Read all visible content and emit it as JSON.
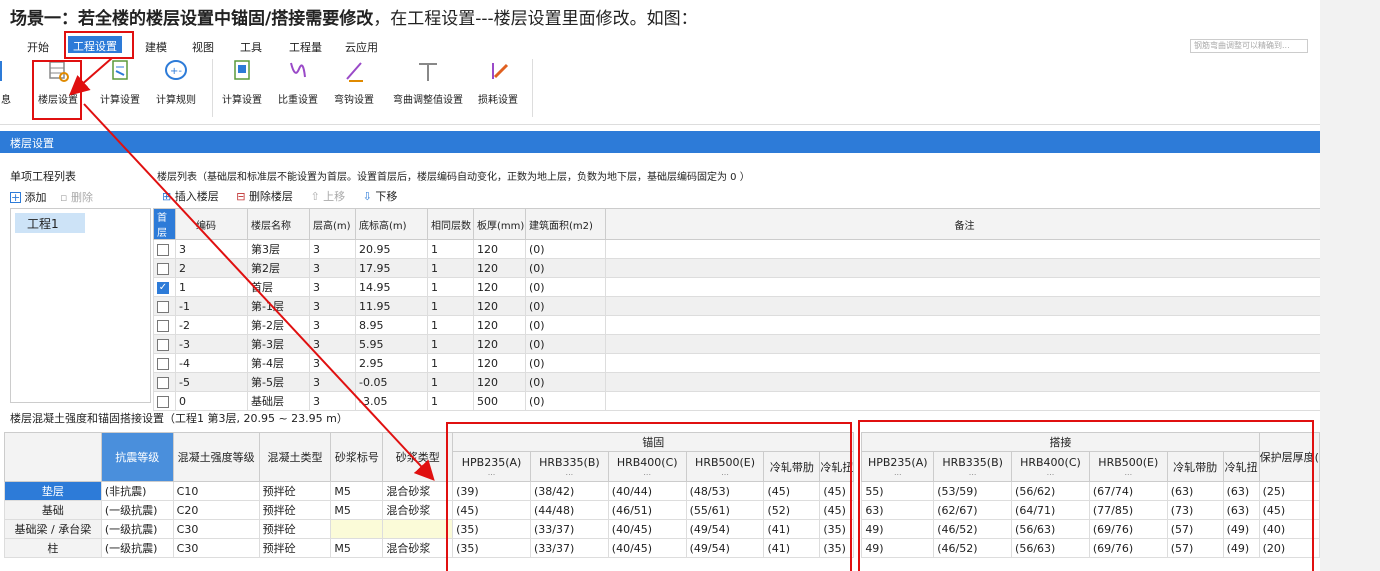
{
  "heading": {
    "bold": "场景一：若全楼的楼层设置中锚固/搭接需要修改",
    "rest": "，在工程设置---楼层设置里面修改。如图："
  },
  "menu": {
    "tabs": [
      "开始",
      "工程设置",
      "建模",
      "视图",
      "工具",
      "工程量",
      "云应用"
    ],
    "active": "工程设置",
    "search_placeholder": "钢筋弯曲调整可以精确到..."
  },
  "ribbon": {
    "buttons": [
      {
        "label": "息",
        "icon": "info-icon"
      },
      {
        "label": "楼层设置",
        "icon": "floor-settings-icon"
      },
      {
        "label": "计算设置",
        "icon": "calc-settings-icon"
      },
      {
        "label": "计算规则",
        "icon": "calc-rules-icon"
      },
      {
        "label": "计算设置",
        "icon": "calc-settings-2-icon"
      },
      {
        "label": "比重设置",
        "icon": "weight-settings-icon"
      },
      {
        "label": "弯钩设置",
        "icon": "hook-settings-icon"
      },
      {
        "label": "弯曲调整值设置",
        "icon": "bend-adjust-icon"
      },
      {
        "label": "损耗设置",
        "icon": "loss-settings-icon"
      }
    ]
  },
  "dialog": {
    "title": "楼层设置"
  },
  "left_panel": {
    "title": "单项工程列表",
    "add_label": "添加",
    "delete_label": "删除",
    "project": "工程1"
  },
  "floor_section": {
    "note": "楼层列表（基础层和标准层不能设置为首层。设置首层后，楼层编码自动变化，正数为地上层，负数为地下层，基础层编码固定为 0 ）",
    "toolbar": {
      "insert": "插入楼层",
      "delete": "删除楼层",
      "up": "上移",
      "down": "下移"
    },
    "columns": [
      "首层",
      "编码",
      "楼层名称",
      "层高(m)",
      "底标高(m)",
      "相同层数",
      "板厚(mm)",
      "建筑面积(m2)",
      "备注"
    ],
    "rows": [
      {
        "checked": false,
        "code": "3",
        "name": "第3层",
        "height": "3",
        "bottom": "20.95",
        "same": "1",
        "thick": "120",
        "area": "(0)",
        "note": ""
      },
      {
        "checked": false,
        "code": "2",
        "name": "第2层",
        "height": "3",
        "bottom": "17.95",
        "same": "1",
        "thick": "120",
        "area": "(0)",
        "note": ""
      },
      {
        "checked": true,
        "code": "1",
        "name": "首层",
        "height": "3",
        "bottom": "14.95",
        "same": "1",
        "thick": "120",
        "area": "(0)",
        "note": ""
      },
      {
        "checked": false,
        "code": "-1",
        "name": "第-1层",
        "height": "3",
        "bottom": "11.95",
        "same": "1",
        "thick": "120",
        "area": "(0)",
        "note": ""
      },
      {
        "checked": false,
        "code": "-2",
        "name": "第-2层",
        "height": "3",
        "bottom": "8.95",
        "same": "1",
        "thick": "120",
        "area": "(0)",
        "note": ""
      },
      {
        "checked": false,
        "code": "-3",
        "name": "第-3层",
        "height": "3",
        "bottom": "5.95",
        "same": "1",
        "thick": "120",
        "area": "(0)",
        "note": ""
      },
      {
        "checked": false,
        "code": "-4",
        "name": "第-4层",
        "height": "3",
        "bottom": "2.95",
        "same": "1",
        "thick": "120",
        "area": "(0)",
        "note": ""
      },
      {
        "checked": false,
        "code": "-5",
        "name": "第-5层",
        "height": "3",
        "bottom": "-0.05",
        "same": "1",
        "thick": "120",
        "area": "(0)",
        "note": ""
      },
      {
        "checked": false,
        "code": "0",
        "name": "基础层",
        "height": "3",
        "bottom": "-3.05",
        "same": "1",
        "thick": "500",
        "area": "(0)",
        "note": ""
      }
    ]
  },
  "anchor_section": {
    "title": "楼层混凝土强度和锚固搭接设置（工程1 第3层, 20.95 ~ 23.95 m）",
    "group_anchor": "锚固",
    "group_lap": "搭接",
    "col_level": "抗震等级",
    "col_strength": "混凝土强度等级",
    "col_concrete_type": "混凝土类型",
    "col_mortar_grade": "砂浆标号",
    "col_mortar_type": "砂浆类型",
    "steel_cols": [
      "HPB235(A)",
      "HRB335(B)",
      "HRB400(C)",
      "HRB500(E)",
      "冷轧带肋",
      "冷轧扭"
    ],
    "steel_sub": "...",
    "col_cover": "保护层厚度(",
    "rows": [
      {
        "name": "垫层",
        "level": "(非抗震)",
        "strength": "C10",
        "ctype": "预拌砼",
        "mgrade": "M5",
        "mtype": "混合砂浆",
        "anchor": [
          "(39)",
          "(38/42)",
          "(40/44)",
          "(48/53)",
          "(45)",
          "(45)"
        ],
        "lap": [
          "55)",
          "(53/59)",
          "(56/62)",
          "(67/74)",
          "(63)",
          "(63)"
        ],
        "cover": "(25)"
      },
      {
        "name": "基础",
        "level": "(一级抗震)",
        "strength": "C20",
        "ctype": "预拌砼",
        "mgrade": "M5",
        "mtype": "混合砂浆",
        "anchor": [
          "(45)",
          "(44/48)",
          "(46/51)",
          "(55/61)",
          "(52)",
          "(45)"
        ],
        "lap": [
          "63)",
          "(62/67)",
          "(64/71)",
          "(77/85)",
          "(73)",
          "(63)"
        ],
        "cover": "(45)"
      },
      {
        "name": "基础梁 / 承台梁",
        "level": "(一级抗震)",
        "strength": "C30",
        "ctype": "预拌砼",
        "mgrade": "",
        "mtype": "",
        "anchor": [
          "(35)",
          "(33/37)",
          "(40/45)",
          "(49/54)",
          "(41)",
          "(35)"
        ],
        "lap": [
          "49)",
          "(46/52)",
          "(56/63)",
          "(69/76)",
          "(57)",
          "(49)"
        ],
        "cover": "(40)"
      },
      {
        "name": "柱",
        "level": "(一级抗震)",
        "strength": "C30",
        "ctype": "预拌砼",
        "mgrade": "M5",
        "mtype": "混合砂浆",
        "anchor": [
          "(35)",
          "(33/37)",
          "(40/45)",
          "(49/54)",
          "(41)",
          "(35)"
        ],
        "lap": [
          "49)",
          "(46/52)",
          "(56/63)",
          "(69/76)",
          "(57)",
          "(49)"
        ],
        "cover": "(20)"
      }
    ]
  },
  "colors": {
    "accent": "#2d7bd8",
    "highlight": "#e01010"
  }
}
